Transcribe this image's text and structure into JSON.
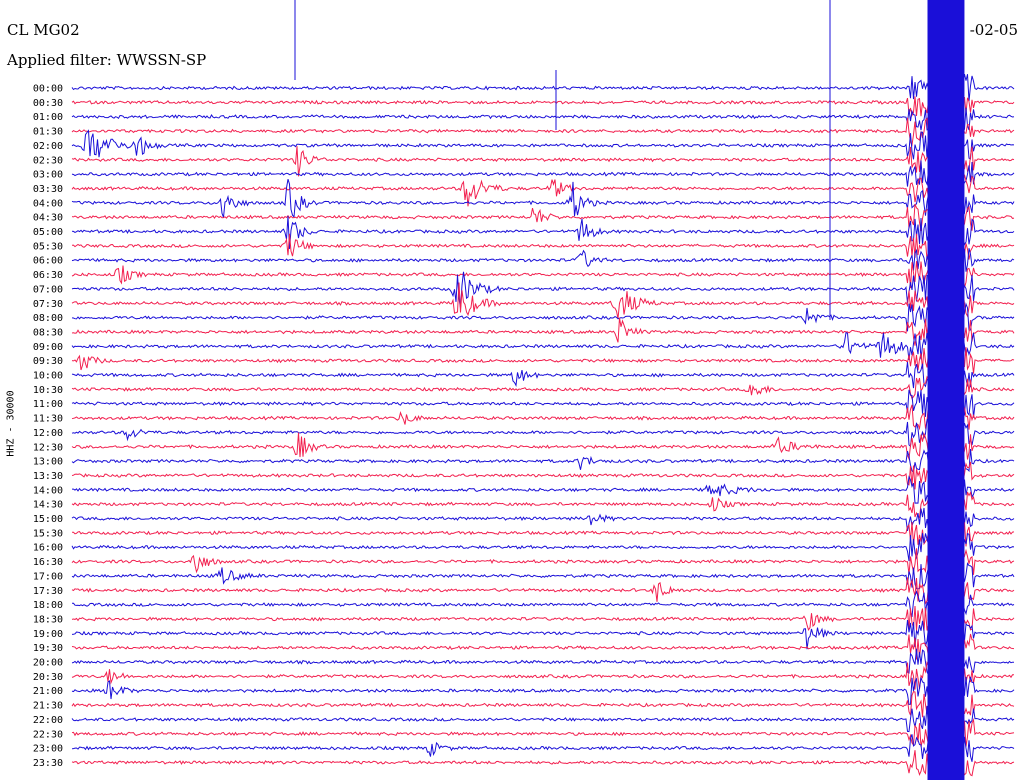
{
  "header": {
    "station": "CL MG02",
    "filter": "Applied filter: WWSSN-SP",
    "date": "-02-05"
  },
  "chart_data": {
    "type": "helicorder",
    "ylabel": "HHZ - 30000",
    "time_labels": [
      "00:00",
      "00:30",
      "01:00",
      "01:30",
      "02:00",
      "02:30",
      "03:00",
      "03:30",
      "04:00",
      "04:30",
      "05:00",
      "05:30",
      "06:00",
      "06:30",
      "07:00",
      "07:30",
      "08:00",
      "08:30",
      "09:00",
      "09:30",
      "10:00",
      "10:30",
      "11:00",
      "11:30",
      "12:00",
      "12:30",
      "13:00",
      "13:30",
      "14:00",
      "14:30",
      "15:00",
      "15:30",
      "16:00",
      "16:30",
      "17:00",
      "17:30",
      "18:00",
      "18:30",
      "19:00",
      "19:30",
      "20:00",
      "20:30",
      "21:00",
      "21:30",
      "22:00",
      "22:30",
      "23:00",
      "23:30"
    ],
    "trace_colors": [
      "#1a0fd8",
      "#f2204f"
    ],
    "events": [
      {
        "row": 4,
        "x": 0.02,
        "amp": 5,
        "w": 0.04
      },
      {
        "row": 4,
        "x": 0.07,
        "amp": 3,
        "w": 0.02
      },
      {
        "row": 5,
        "x": 0.24,
        "amp": 4,
        "w": 0.02
      },
      {
        "row": 7,
        "x": 0.42,
        "amp": 5,
        "w": 0.03
      },
      {
        "row": 7,
        "x": 0.51,
        "amp": 3,
        "w": 0.02
      },
      {
        "row": 8,
        "x": 0.16,
        "amp": 5,
        "w": 0.02
      },
      {
        "row": 8,
        "x": 0.23,
        "amp": 6,
        "w": 0.02
      },
      {
        "row": 8,
        "x": 0.53,
        "amp": 6,
        "w": 0.02
      },
      {
        "row": 9,
        "x": 0.49,
        "amp": 3,
        "w": 0.02
      },
      {
        "row": 10,
        "x": 0.23,
        "amp": 5,
        "w": 0.02
      },
      {
        "row": 10,
        "x": 0.54,
        "amp": 4,
        "w": 0.02
      },
      {
        "row": 11,
        "x": 0.23,
        "amp": 4,
        "w": 0.02
      },
      {
        "row": 12,
        "x": 0.54,
        "amp": 3,
        "w": 0.02
      },
      {
        "row": 13,
        "x": 0.05,
        "amp": 3,
        "w": 0.02
      },
      {
        "row": 14,
        "x": 0.41,
        "amp": 6,
        "w": 0.03
      },
      {
        "row": 15,
        "x": 0.41,
        "amp": 6,
        "w": 0.03
      },
      {
        "row": 15,
        "x": 0.58,
        "amp": 5,
        "w": 0.03
      },
      {
        "row": 16,
        "x": 0.78,
        "amp": 3,
        "w": 0.02
      },
      {
        "row": 17,
        "x": 0.58,
        "amp": 4,
        "w": 0.02
      },
      {
        "row": 18,
        "x": 0.82,
        "amp": 4,
        "w": 0.02
      },
      {
        "row": 18,
        "x": 0.86,
        "amp": 4,
        "w": 0.03
      },
      {
        "row": 19,
        "x": 0.01,
        "amp": 3,
        "w": 0.02
      },
      {
        "row": 20,
        "x": 0.47,
        "amp": 3,
        "w": 0.02
      },
      {
        "row": 21,
        "x": 0.72,
        "amp": 3,
        "w": 0.02
      },
      {
        "row": 23,
        "x": 0.35,
        "amp": 2,
        "w": 0.02
      },
      {
        "row": 24,
        "x": 0.06,
        "amp": 2,
        "w": 0.02
      },
      {
        "row": 25,
        "x": 0.24,
        "amp": 4,
        "w": 0.02
      },
      {
        "row": 25,
        "x": 0.75,
        "amp": 2,
        "w": 0.03
      },
      {
        "row": 26,
        "x": 0.54,
        "amp": 2,
        "w": 0.02
      },
      {
        "row": 28,
        "x": 0.68,
        "amp": 2,
        "w": 0.04
      },
      {
        "row": 29,
        "x": 0.68,
        "amp": 2,
        "w": 0.02
      },
      {
        "row": 30,
        "x": 0.55,
        "amp": 2,
        "w": 0.02
      },
      {
        "row": 33,
        "x": 0.13,
        "amp": 4,
        "w": 0.02
      },
      {
        "row": 34,
        "x": 0.16,
        "amp": 2,
        "w": 0.03
      },
      {
        "row": 35,
        "x": 0.62,
        "amp": 3,
        "w": 0.02
      },
      {
        "row": 37,
        "x": 0.78,
        "amp": 3,
        "w": 0.02
      },
      {
        "row": 38,
        "x": 0.78,
        "amp": 4,
        "w": 0.02
      },
      {
        "row": 41,
        "x": 0.04,
        "amp": 2,
        "w": 0.02
      },
      {
        "row": 42,
        "x": 0.04,
        "amp": 3,
        "w": 0.02
      },
      {
        "row": 46,
        "x": 0.38,
        "amp": 2,
        "w": 0.02
      }
    ],
    "saturated_band": {
      "x_from": 0.886,
      "x_to": 0.957,
      "row_from": 0,
      "row_to": 48
    }
  }
}
